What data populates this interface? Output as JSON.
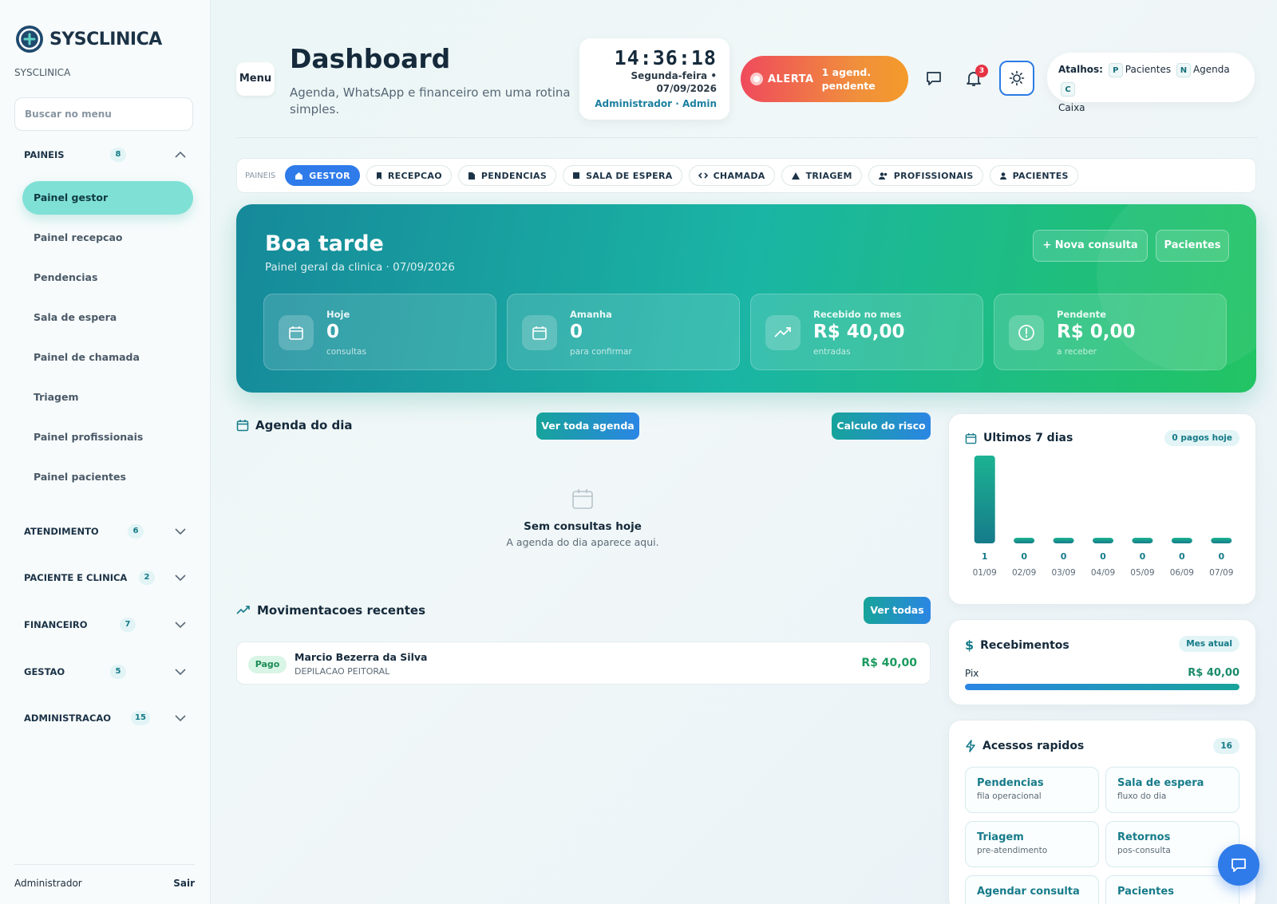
{
  "sidebar": {
    "brand": "SYSCLINICA",
    "brand_sub": "SYSCLINICA",
    "search_placeholder": "Buscar no menu",
    "groups": [
      {
        "name": "PAINEIS",
        "count": "8"
      },
      {
        "name": "ATENDIMENTO",
        "count": "6"
      },
      {
        "name": "PACIENTE E CLINICA",
        "count": "2"
      },
      {
        "name": "FINANCEIRO",
        "count": "7"
      },
      {
        "name": "GESTAO",
        "count": "5"
      },
      {
        "name": "ADMINISTRACAO",
        "count": "15"
      }
    ],
    "items": [
      {
        "label": "Painel gestor"
      },
      {
        "label": "Painel recepcao"
      },
      {
        "label": "Pendencias"
      },
      {
        "label": "Sala de espera"
      },
      {
        "label": "Painel de chamada"
      },
      {
        "label": "Triagem"
      },
      {
        "label": "Painel profissionais"
      },
      {
        "label": "Painel pacientes"
      }
    ],
    "footer_user": "Administrador",
    "footer_logout": "Sair"
  },
  "header": {
    "menu_label": "Menu",
    "title": "Dashboard",
    "subtitle": "Agenda, WhatsApp e financeiro em uma rotina simples.",
    "clock_time": "14:36:18",
    "clock_date": "Segunda-feira • 07/09/2026",
    "clock_user": "Administrador · Admin",
    "alert_label": "ALERTA",
    "alert_text": "1 agend. pendente",
    "notif_count": "3",
    "shortcuts_label": "Atalhos:",
    "shortcuts": [
      {
        "key": "P",
        "label": "Pacientes"
      },
      {
        "key": "N",
        "label": "Agenda"
      },
      {
        "key": "C",
        "label": "Caixa"
      }
    ]
  },
  "tabs": {
    "label": "PAINEIS",
    "items": [
      {
        "label": "GESTOR",
        "icon": "house-icon"
      },
      {
        "label": "RECEPCAO",
        "icon": "bookmark-icon"
      },
      {
        "label": "PENDENCIAS",
        "icon": "doc-icon"
      },
      {
        "label": "SALA DE ESPERA",
        "icon": "square-icon"
      },
      {
        "label": "CHAMADA",
        "icon": "arrows-icon"
      },
      {
        "label": "TRIAGEM",
        "icon": "triangle-icon"
      },
      {
        "label": "PROFISSIONAIS",
        "icon": "users-icon"
      },
      {
        "label": "PACIENTES",
        "icon": "user-icon"
      }
    ]
  },
  "hero": {
    "greeting": "Boa tarde",
    "subtitle": "Painel geral da clinica · 07/09/2026",
    "new_btn": "Nova consulta",
    "patients_btn": "Pacientes",
    "kpis": [
      {
        "label": "Hoje",
        "value": "0",
        "sub": "consultas",
        "icon": "calendar-icon"
      },
      {
        "label": "Amanha",
        "value": "0",
        "sub": "para confirmar",
        "icon": "calendar-icon"
      },
      {
        "label": "Recebido no mes",
        "value": "R$ 40,00",
        "sub": "entradas",
        "icon": "trend-up-icon"
      },
      {
        "label": "Pendente",
        "value": "R$ 0,00",
        "sub": "a receber",
        "icon": "alert-circle-icon"
      }
    ]
  },
  "agenda": {
    "title": "Agenda do dia",
    "view_all_btn": "Ver toda agenda",
    "risk_btn": "Calculo do risco",
    "empty_title": "Sem consultas hoje",
    "empty_sub": "A agenda do dia aparece aqui."
  },
  "movements": {
    "title": "Movimentacoes recentes",
    "view_all_btn": "Ver todas",
    "rows": [
      {
        "status": "Pago",
        "name": "Marcio Bezerra da Silva",
        "desc": "DEPILACAO PEITORAL",
        "value": "R$ 40,00"
      }
    ]
  },
  "last7": {
    "title": "Ultimos 7 dias",
    "badge": "0 pagos hoje"
  },
  "chart_data": {
    "type": "bar",
    "categories": [
      "01/09",
      "02/09",
      "03/09",
      "04/09",
      "05/09",
      "06/09",
      "07/09"
    ],
    "values": [
      1,
      0,
      0,
      0,
      0,
      0,
      0
    ],
    "title": "Ultimos 7 dias",
    "xlabel": "",
    "ylabel": "",
    "ylim": [
      0,
      1
    ],
    "grid": false,
    "colors": [
      "#1cb392",
      "#167b8a"
    ]
  },
  "receipts": {
    "title": "Recebimentos",
    "badge": "Mes atual",
    "method": "Pix",
    "value": "R$ 40,00",
    "fill_fraction": 1.0
  },
  "quick": {
    "title": "Acessos rapidos",
    "count": "16",
    "items": [
      {
        "title": "Pendencias",
        "sub": "fila operacional"
      },
      {
        "title": "Sala de espera",
        "sub": "fluxo do dia"
      },
      {
        "title": "Triagem",
        "sub": "pre-atendimento"
      },
      {
        "title": "Retornos",
        "sub": "pos-consulta"
      },
      {
        "title": "Agendar consulta",
        "sub": ""
      },
      {
        "title": "Pacientes",
        "sub": ""
      }
    ]
  },
  "colors": {
    "accent": "#2f7bea",
    "teal": "#17a39a",
    "success": "#1a9a5e",
    "alert": "#ef4a5c"
  }
}
